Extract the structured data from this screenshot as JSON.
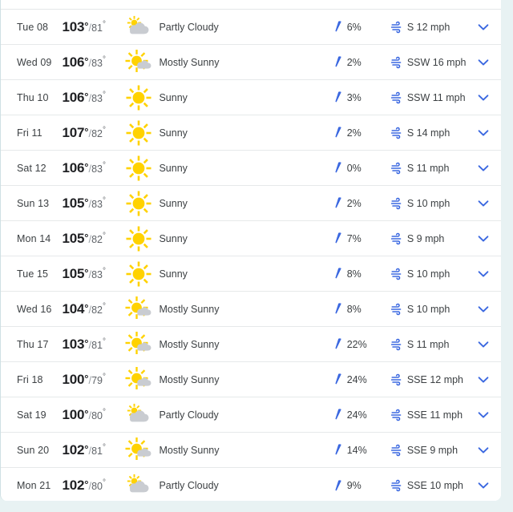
{
  "card": {
    "accent_blue": "#3b68e0",
    "sun_color": "#ffd200",
    "cloud_color": "#c9ccd1",
    "scrollbar_color": "#5ba3c4"
  },
  "icons": {
    "precip": "raindrop-icon",
    "wind": "wind-icon",
    "expand": "chevron-down-icon",
    "sunny": "sun-icon",
    "mostly_sunny": "sun-behind-small-cloud-icon",
    "partly_cloudy": "sun-behind-large-cloud-icon"
  },
  "forecast": {
    "rows": [
      {
        "day": "Tue 08",
        "high": "103",
        "low": "81",
        "condition": "Partly Cloudy",
        "icon": "partly_cloudy",
        "precip": "6%",
        "wind": "S 12 mph"
      },
      {
        "day": "Wed 09",
        "high": "106",
        "low": "83",
        "condition": "Mostly Sunny",
        "icon": "mostly_sunny",
        "precip": "2%",
        "wind": "SSW 16 mph"
      },
      {
        "day": "Thu 10",
        "high": "106",
        "low": "83",
        "condition": "Sunny",
        "icon": "sunny",
        "precip": "3%",
        "wind": "SSW 11 mph"
      },
      {
        "day": "Fri 11",
        "high": "107",
        "low": "82",
        "condition": "Sunny",
        "icon": "sunny",
        "precip": "2%",
        "wind": "S 14 mph"
      },
      {
        "day": "Sat 12",
        "high": "106",
        "low": "83",
        "condition": "Sunny",
        "icon": "sunny",
        "precip": "0%",
        "wind": "S 11 mph"
      },
      {
        "day": "Sun 13",
        "high": "105",
        "low": "83",
        "condition": "Sunny",
        "icon": "sunny",
        "precip": "2%",
        "wind": "S 10 mph"
      },
      {
        "day": "Mon 14",
        "high": "105",
        "low": "82",
        "condition": "Sunny",
        "icon": "sunny",
        "precip": "7%",
        "wind": "S 9 mph"
      },
      {
        "day": "Tue 15",
        "high": "105",
        "low": "83",
        "condition": "Sunny",
        "icon": "sunny",
        "precip": "8%",
        "wind": "S 10 mph"
      },
      {
        "day": "Wed 16",
        "high": "104",
        "low": "82",
        "condition": "Mostly Sunny",
        "icon": "mostly_sunny",
        "precip": "8%",
        "wind": "S 10 mph"
      },
      {
        "day": "Thu 17",
        "high": "103",
        "low": "81",
        "condition": "Mostly Sunny",
        "icon": "mostly_sunny",
        "precip": "22%",
        "wind": "S 11 mph"
      },
      {
        "day": "Fri 18",
        "high": "100",
        "low": "79",
        "condition": "Mostly Sunny",
        "icon": "mostly_sunny",
        "precip": "24%",
        "wind": "SSE 12 mph"
      },
      {
        "day": "Sat 19",
        "high": "100",
        "low": "80",
        "condition": "Partly Cloudy",
        "icon": "partly_cloudy",
        "precip": "24%",
        "wind": "SSE 11 mph"
      },
      {
        "day": "Sun 20",
        "high": "102",
        "low": "81",
        "condition": "Mostly Sunny",
        "icon": "mostly_sunny",
        "precip": "14%",
        "wind": "SSE 9 mph"
      },
      {
        "day": "Mon 21",
        "high": "102",
        "low": "80",
        "condition": "Partly Cloudy",
        "icon": "partly_cloudy",
        "precip": "9%",
        "wind": "SSE 10 mph"
      }
    ]
  }
}
